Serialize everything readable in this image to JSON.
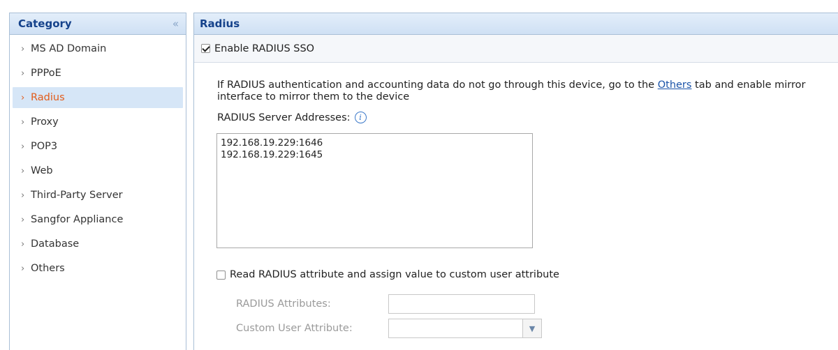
{
  "category": {
    "title": "Category",
    "collapse_icon": "double-chevron-left-icon",
    "items": [
      {
        "label": "MS AD Domain"
      },
      {
        "label": "PPPoE"
      },
      {
        "label": "Radius",
        "active": true
      },
      {
        "label": "Proxy"
      },
      {
        "label": "POP3"
      },
      {
        "label": "Web"
      },
      {
        "label": "Third-Party Server"
      },
      {
        "label": "Sangfor Appliance"
      },
      {
        "label": "Database"
      },
      {
        "label": "Others"
      }
    ],
    "arrow": "›"
  },
  "radius": {
    "title": "Radius",
    "enable_sso_label": "Enable RADIUS SSO",
    "enable_sso_checked": true,
    "info_text_before": "If RADIUS authentication and accounting data do not go through this device, go to the ",
    "info_link": "Others",
    "info_text_after": " tab and enable mirror interface to mirror them to the device",
    "servers_label": "RADIUS Server Addresses:",
    "servers_value": "192.168.19.229:1646\n192.168.19.229:1645",
    "read_attr_label": "Read RADIUS attribute and assign value to custom user attribute",
    "read_attr_checked": false,
    "radius_attributes_label": "RADIUS Attributes:",
    "radius_attributes_value": "",
    "custom_user_attribute_label": "Custom User Attribute:",
    "custom_user_attribute_value": ""
  },
  "colors": {
    "header_text": "#15428b",
    "active_item_text": "#e25c1a",
    "active_item_bg": "#d6e6f7",
    "link": "#1a53a8"
  }
}
